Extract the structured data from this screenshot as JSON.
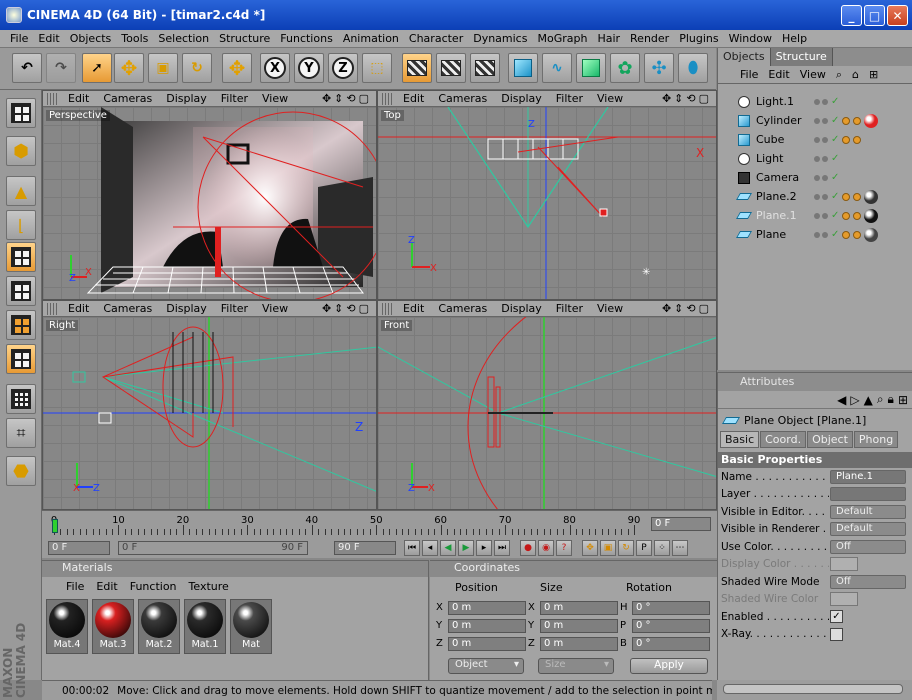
{
  "window": {
    "title": "CINEMA 4D (64 Bit) - [timar2.c4d *]"
  },
  "menubar": [
    "File",
    "Edit",
    "Objects",
    "Tools",
    "Selection",
    "Structure",
    "Functions",
    "Animation",
    "Character",
    "Dynamics",
    "MoGraph",
    "Hair",
    "Render",
    "Plugins",
    "Window",
    "Help"
  ],
  "toolbar": {
    "axis_x": "X",
    "axis_y": "Y",
    "axis_z": "Z"
  },
  "viewport_menu": [
    "Edit",
    "Cameras",
    "Display",
    "Filter",
    "View"
  ],
  "viewports": {
    "perspective": "Perspective",
    "top": "Top",
    "right": "Right",
    "front": "Front"
  },
  "object_manager": {
    "tabs": [
      "Objects",
      "Structure"
    ],
    "menu": [
      "File",
      "Edit",
      "View"
    ],
    "objects": [
      {
        "name": "Light.1",
        "icon": "light-icon",
        "dim": false,
        "tags": 0,
        "mat": ""
      },
      {
        "name": "Cylinder",
        "icon": "cylinder-icon",
        "dim": false,
        "tags": 2,
        "mat": "#e02020"
      },
      {
        "name": "Cube",
        "icon": "cube-icon",
        "dim": false,
        "tags": 2,
        "mat": ""
      },
      {
        "name": "Light",
        "icon": "light-icon",
        "dim": false,
        "tags": 0,
        "mat": ""
      },
      {
        "name": "Camera",
        "icon": "camera-icon",
        "dim": false,
        "tags": 0,
        "mat": ""
      },
      {
        "name": "Plane.2",
        "icon": "plane-icon",
        "dim": false,
        "tags": 2,
        "mat": "#333333"
      },
      {
        "name": "Plane.1",
        "icon": "plane-icon",
        "dim": true,
        "tags": 2,
        "mat": "#111111"
      },
      {
        "name": "Plane",
        "icon": "plane-icon",
        "dim": false,
        "tags": 2,
        "mat": "#444444"
      }
    ]
  },
  "attributes": {
    "header": "Attributes",
    "object_title": "Plane Object [Plane.1]",
    "tabs": [
      "Basic",
      "Coord.",
      "Object",
      "Phong"
    ],
    "section": "Basic Properties",
    "props": [
      {
        "label": "Name . . . . . . . . . . . . .",
        "value": "Plane.1",
        "type": "text",
        "dim": false
      },
      {
        "label": "Layer . . . . . . . . . . . . .",
        "value": "",
        "type": "text",
        "dim": false
      },
      {
        "label": "Visible in Editor. . . . . .",
        "value": "Default",
        "type": "drop",
        "dim": false
      },
      {
        "label": "Visible in Renderer . . .",
        "value": "Default",
        "type": "drop",
        "dim": false
      },
      {
        "label": "Use Color. . . . . . . . . .",
        "value": "Off",
        "type": "drop",
        "dim": false
      },
      {
        "label": "Display Color . . . . . . .",
        "value": "",
        "type": "swatch",
        "dim": true
      },
      {
        "label": "Shaded Wire Mode",
        "value": "Off",
        "type": "drop",
        "dim": false
      },
      {
        "label": "Shaded Wire Color",
        "value": "",
        "type": "swatch",
        "dim": true
      },
      {
        "label": "Enabled . . . . . . . . . . .",
        "value": "✓",
        "type": "check",
        "dim": false
      },
      {
        "label": "X-Ray. . . . . . . . . . . . .",
        "value": "",
        "type": "check",
        "dim": false
      }
    ]
  },
  "timeline": {
    "ticks": [
      "0",
      "10",
      "20",
      "30",
      "40",
      "50",
      "60",
      "70",
      "80",
      "90"
    ],
    "current": "0 F",
    "start": "0 F",
    "range_start": "0 F",
    "range_end": "90 F",
    "end": "90 F"
  },
  "materials": {
    "header": "Materials",
    "menu": [
      "File",
      "Edit",
      "Function",
      "Texture"
    ],
    "items": [
      {
        "name": "Mat.4",
        "color": "#222222"
      },
      {
        "name": "Mat.3",
        "color": "#d82020"
      },
      {
        "name": "Mat.2",
        "color": "#3a3a3a"
      },
      {
        "name": "Mat.1",
        "color": "#2b2b2b"
      },
      {
        "name": "Mat",
        "color": "#4a4a4a"
      }
    ]
  },
  "coordinates": {
    "header": "Coordinates",
    "col_position": "Position",
    "col_size": "Size",
    "col_rotation": "Rotation",
    "rows": [
      {
        "axis": "X",
        "pos": "0 m",
        "saxis": "X",
        "size": "0 m",
        "raxis": "H",
        "rot": "0 °"
      },
      {
        "axis": "Y",
        "pos": "0 m",
        "saxis": "Y",
        "size": "0 m",
        "raxis": "P",
        "rot": "0 °"
      },
      {
        "axis": "Z",
        "pos": "0 m",
        "saxis": "Z",
        "size": "0 m",
        "raxis": "B",
        "rot": "0 °"
      }
    ],
    "mode": "Object",
    "size_mode": "Size",
    "apply": "Apply"
  },
  "statusbar": {
    "time": "00:00:02",
    "message": "Move: Click and drag to move elements. Hold down SHIFT to quantize movement / add to the selection in point mode, CTRL to remove"
  },
  "brand": "MAXON CINEMA 4D"
}
